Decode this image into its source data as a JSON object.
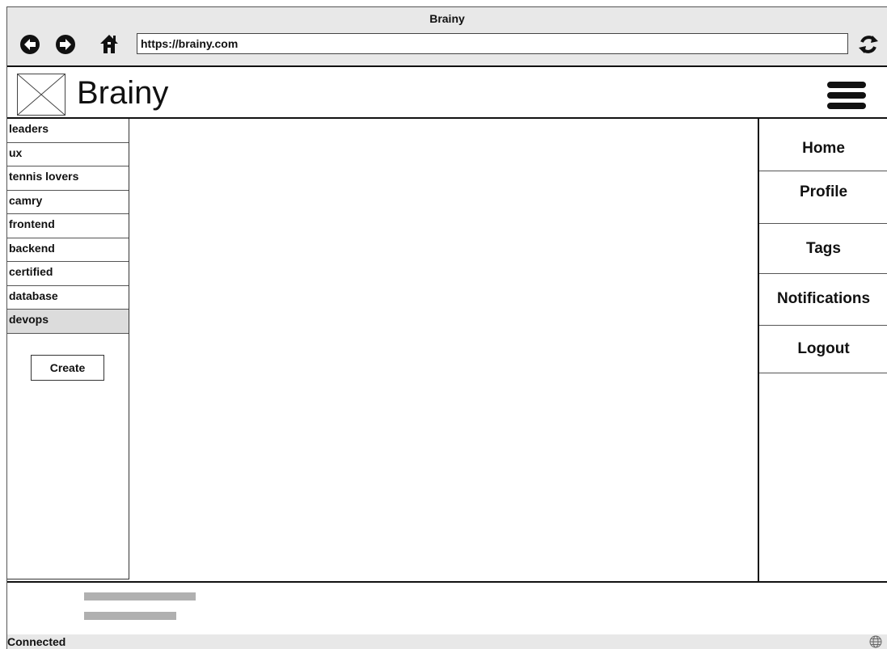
{
  "window": {
    "title": "Brainy"
  },
  "browser": {
    "url": "https://brainy.com",
    "icons": {
      "back": "back-arrow-icon",
      "forward": "forward-arrow-icon",
      "home": "home-icon",
      "reload": "reload-icon"
    }
  },
  "header": {
    "brand": "Brainy",
    "logo_icon": "image-placeholder-icon",
    "menu_icon": "hamburger-menu-icon"
  },
  "sidebar": {
    "tags": [
      {
        "label": "leaders",
        "selected": false
      },
      {
        "label": "ux",
        "selected": false
      },
      {
        "label": "tennis lovers",
        "selected": false
      },
      {
        "label": "camry",
        "selected": false
      },
      {
        "label": "frontend",
        "selected": false
      },
      {
        "label": "backend",
        "selected": false
      },
      {
        "label": "certified",
        "selected": false
      },
      {
        "label": "database",
        "selected": false
      },
      {
        "label": "devops",
        "selected": true
      }
    ],
    "create_label": "Create"
  },
  "rightnav": {
    "items": [
      {
        "label": "Home"
      },
      {
        "label": "Profile"
      },
      {
        "label": "Tags"
      },
      {
        "label": "Notifications"
      },
      {
        "label": "Logout"
      }
    ]
  },
  "statusbar": {
    "text": "Connected",
    "icon": "globe-icon"
  },
  "colors": {
    "chrome": "#e8e8e8",
    "selected": "#dcdcdc",
    "placeholder_text": "#b0b0b0",
    "border": "#111111"
  }
}
